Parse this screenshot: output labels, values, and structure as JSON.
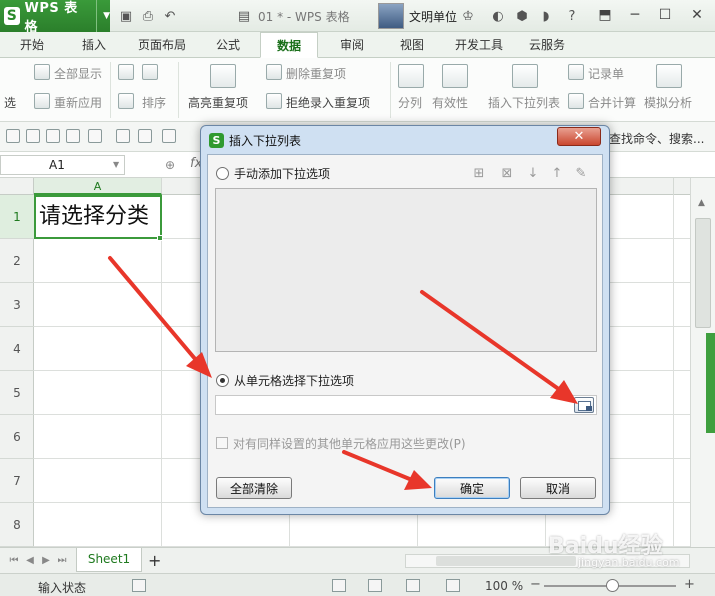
{
  "app": {
    "name": "WPS 表格",
    "logo_letter": "S",
    "document_title": "01 * - WPS 表格",
    "user_name": "文明单位"
  },
  "ribbon_tabs": [
    "开始",
    "插入",
    "页面布局",
    "公式",
    "数据",
    "审阅",
    "视图",
    "开发工具",
    "云服务"
  ],
  "active_tab": "数据",
  "ribbon": {
    "filter_partial": "选",
    "show_all": "全部显示",
    "reapply": "重新应用",
    "sort": "排序",
    "highlight_duplicates": "高亮重复项",
    "remove_duplicates": "删除重复项",
    "reject_duplicates": "拒绝录入重复项",
    "split": "分列",
    "validity": "有效性",
    "insert_dropdown": "插入下拉列表",
    "record_sheet": "记录单",
    "merge_calc": "合并计算",
    "simulate": "模拟分析"
  },
  "toolbar": {
    "search_commands": "查找命令、搜索..."
  },
  "formula_bar": {
    "name_box": "A1",
    "fx": "fx"
  },
  "grid": {
    "column_headers": [
      "A"
    ],
    "row_numbers": [
      "1",
      "2",
      "3",
      "4",
      "5",
      "6",
      "7",
      "8"
    ],
    "cell_a1": "请选择分类"
  },
  "sheets": {
    "active": "Sheet1",
    "add_symbol": "+"
  },
  "status": {
    "mode": "输入状态",
    "zoom": "100 %"
  },
  "dialog": {
    "title": "插入下拉列表",
    "close_symbol": "✕",
    "option_manual": "手动添加下拉选项",
    "option_from_cells": "从单元格选择下拉选项",
    "selected_option": "option_from_cells",
    "range_value": "",
    "apply_same_settings": "对有同样设置的其他单元格应用这些更改(P)",
    "clear_all": "全部清除",
    "ok": "确定",
    "cancel": "取消"
  },
  "annotations": {
    "arrow_color": "#e8362a"
  },
  "watermark": {
    "brand": "Baidu经验",
    "url": "jingyan.baidu.com"
  },
  "colors": {
    "brand_green": "#2b8a2b",
    "selection_green": "#3b9a3b",
    "dialog_frame": "#cfe0f2"
  }
}
